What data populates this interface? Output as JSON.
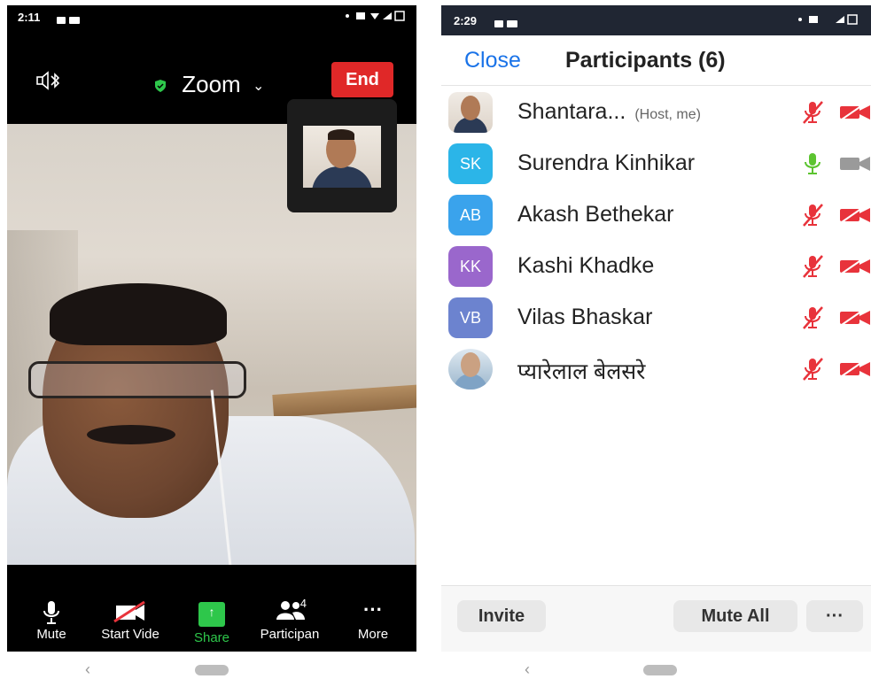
{
  "left": {
    "status": {
      "time": "2:11"
    },
    "meeting": {
      "title": "Zoom",
      "end_label": "End"
    },
    "toolbar": {
      "mute": "Mute",
      "start_video": "Start Vide",
      "share": "Share",
      "participants": "Participan",
      "participants_count": "4",
      "more": "More"
    }
  },
  "right": {
    "status": {
      "time": "2:29"
    },
    "header": {
      "close": "Close",
      "title": "Participants (6)"
    },
    "participants": [
      {
        "avatar": "photo",
        "name": "Shantara...",
        "tag": "(Host, me)",
        "mic": "muted",
        "video": "off"
      },
      {
        "avatar": "SK",
        "color": "#2bb5e8",
        "name": "Surendra Kinhikar",
        "mic": "on",
        "video": "off-gray"
      },
      {
        "avatar": "AB",
        "color": "#3aa3ec",
        "name": "Akash Bethekar",
        "mic": "muted",
        "video": "off"
      },
      {
        "avatar": "KK",
        "color": "#9a67cc",
        "name": "Kashi Khadke",
        "mic": "muted",
        "video": "off"
      },
      {
        "avatar": "VB",
        "color": "#6c83cf",
        "name": "Vilas Bhaskar",
        "mic": "muted",
        "video": "off"
      },
      {
        "avatar": "photo2",
        "name": "प्यारेलाल बेलसरे",
        "mic": "muted",
        "video": "off"
      }
    ],
    "footer": {
      "invite": "Invite",
      "mute_all": "Mute All",
      "more": "···"
    }
  },
  "colors": {
    "end_red": "#e02828",
    "share_green": "#2ec74b",
    "link_blue": "#1a73e8",
    "muted_red": "#e8333b",
    "mic_green": "#5cc430"
  }
}
